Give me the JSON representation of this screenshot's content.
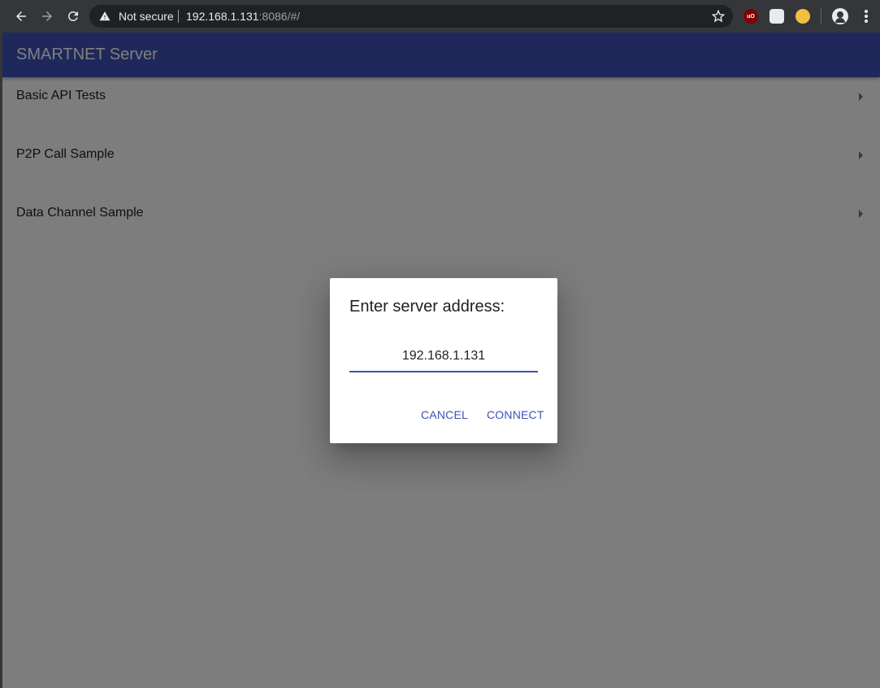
{
  "browser": {
    "security_label": "Not secure",
    "url_host": "192.168.1.131",
    "url_rest": ":8086/#/",
    "extensions": [
      "ublock-icon",
      "extension-icon",
      "extension-icon"
    ]
  },
  "app": {
    "title": "SMARTNET Server",
    "accent_color": "#3f51b5"
  },
  "list": {
    "items": [
      {
        "label": "Basic API Tests"
      },
      {
        "label": "P2P Call Sample"
      },
      {
        "label": "Data Channel Sample"
      }
    ]
  },
  "dialog": {
    "title": "Enter server address:",
    "input_value": "192.168.1.131",
    "cancel_label": "CANCEL",
    "connect_label": "CONNECT"
  }
}
